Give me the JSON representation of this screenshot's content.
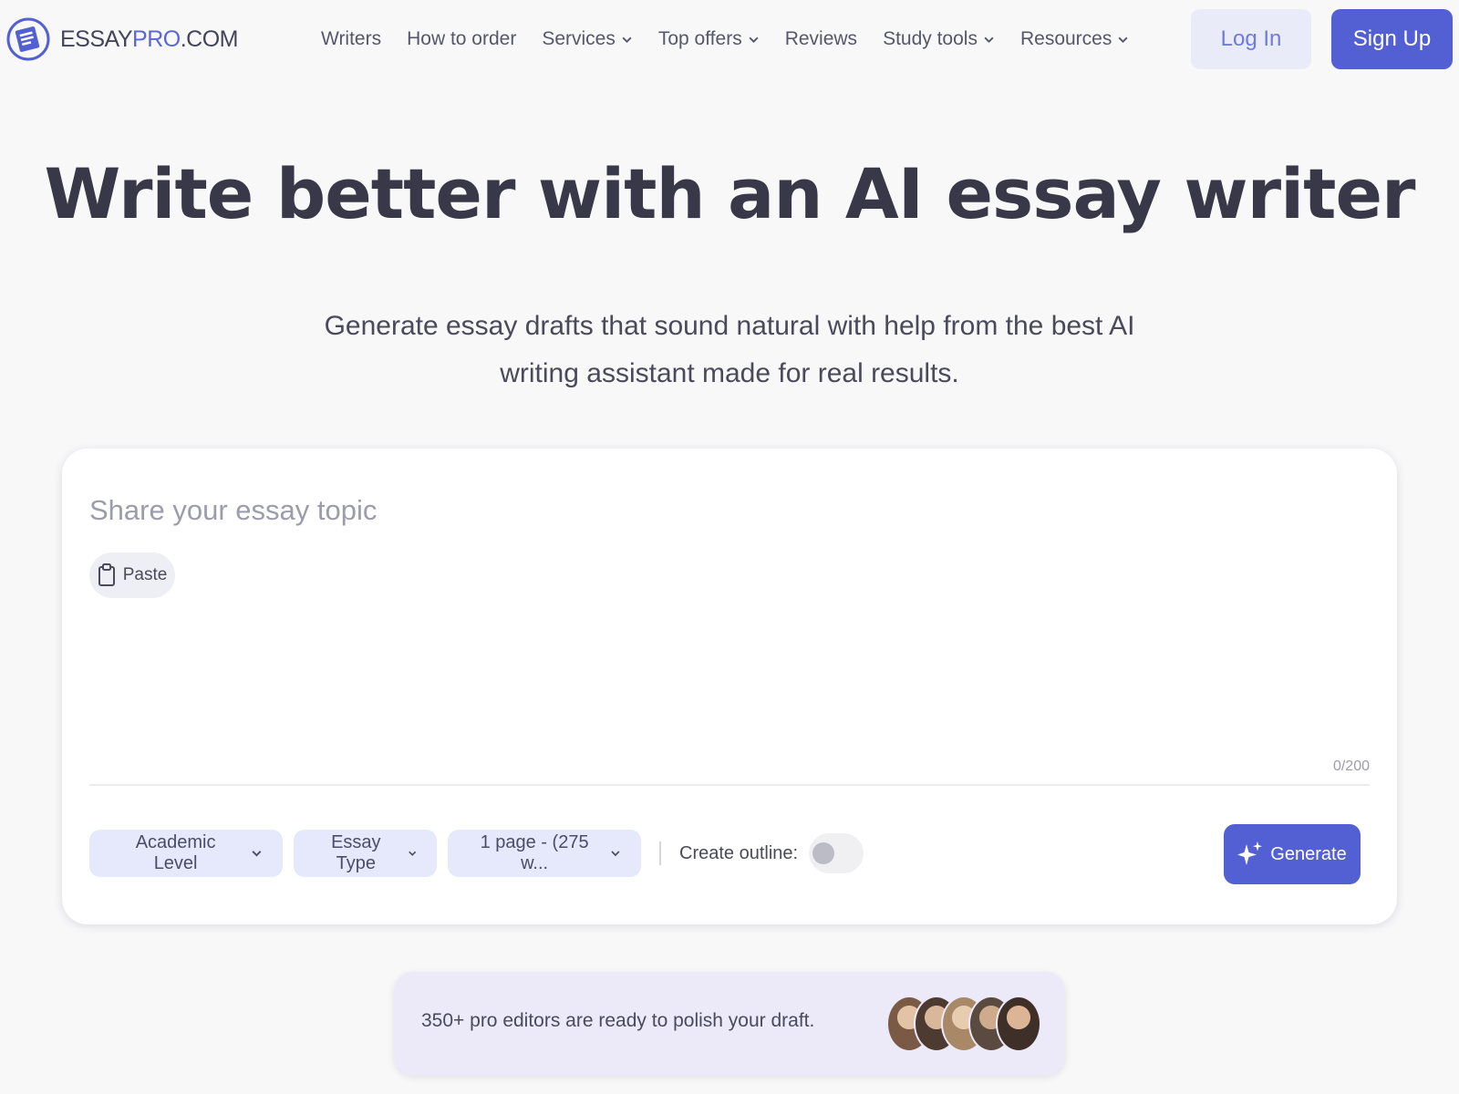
{
  "header": {
    "logo_text_left": "ESSAY",
    "logo_text_pro": "PRO",
    "logo_text_right": ".COM",
    "nav": [
      {
        "label": "Writers",
        "dropdown": false
      },
      {
        "label": "How to order",
        "dropdown": false
      },
      {
        "label": "Services",
        "dropdown": true
      },
      {
        "label": "Top offers",
        "dropdown": true
      },
      {
        "label": "Reviews",
        "dropdown": false
      },
      {
        "label": "Study tools",
        "dropdown": true
      },
      {
        "label": "Resources",
        "dropdown": true
      }
    ],
    "login_label": "Log In",
    "signup_label": "Sign Up"
  },
  "hero": {
    "title": "Write better with an AI essay writer",
    "subtitle_line1": "Generate essay drafts that sound natural with help from the best AI",
    "subtitle_line2": "writing assistant made for real results."
  },
  "editor": {
    "placeholder": "Share your essay topic",
    "paste_label": "Paste",
    "counter": "0/200",
    "academic_level_label": "Academic Level",
    "essay_type_label": "Essay Type",
    "length_label": "1 page - (275 w...",
    "create_outline_label": "Create outline:",
    "create_outline_on": false,
    "generate_label": "Generate"
  },
  "banner": {
    "text": "350+ pro editors are ready to polish your draft."
  },
  "colors": {
    "accent": "#5360d3",
    "accent_light": "#e6e9fb",
    "background": "#f8f8f9",
    "heading": "#383848"
  }
}
